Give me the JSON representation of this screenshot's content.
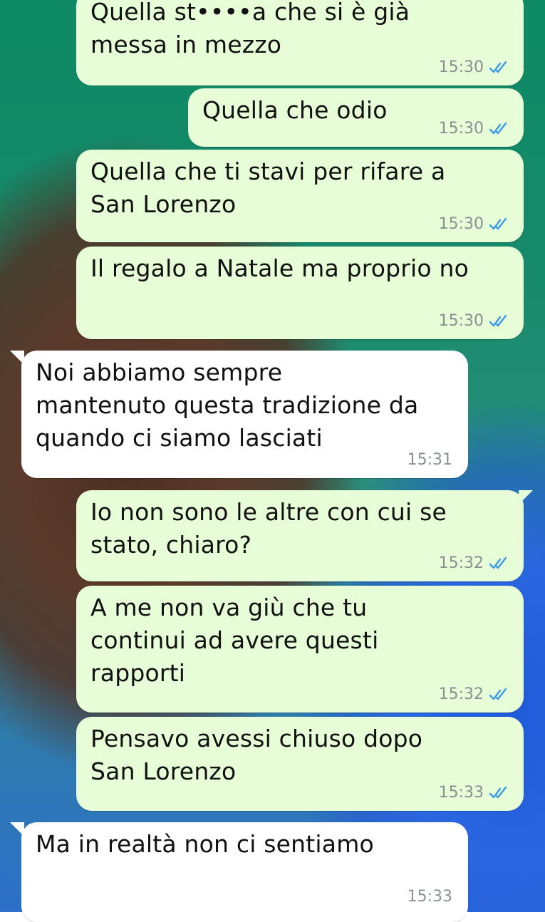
{
  "messages": [
    {
      "text": "Quella st••••a che si è già\nmessa in mezzo",
      "time": "15:30",
      "status_icon": "double-check-icon"
    },
    {
      "text": "Quella che odio",
      "time": "15:30",
      "status_icon": "double-check-icon"
    },
    {
      "text": "Quella che ti stavi per rifare a\nSan Lorenzo",
      "time": "15:30",
      "status_icon": "double-check-icon"
    },
    {
      "text": "Il regalo a Natale ma proprio no",
      "time": "15:30",
      "status_icon": "double-check-icon"
    },
    {
      "text": "Noi abbiamo sempre\nmantenuto questa tradizione da\nquando ci siamo lasciati",
      "time": "15:31"
    },
    {
      "text": "Io non sono le altre con cui se\nstato, chiaro?",
      "time": "15:32",
      "status_icon": "double-check-icon"
    },
    {
      "text": "A me non va giù che  tu\ncontinui ad avere questi\nrapporti",
      "time": "15:32",
      "status_icon": "double-check-icon"
    },
    {
      "text": "Pensavo avessi chiuso dopo\nSan Lorenzo",
      "time": "15:33",
      "status_icon": "double-check-icon"
    },
    {
      "text": "Ma in realtà non ci sentiamo",
      "time": "15:33"
    }
  ],
  "colors": {
    "outgoing_bubble": "#e7fdd8",
    "incoming_bubble": "#ffffff",
    "read_ticks": "#3b9be8",
    "timestamp": "#8a8f93"
  }
}
